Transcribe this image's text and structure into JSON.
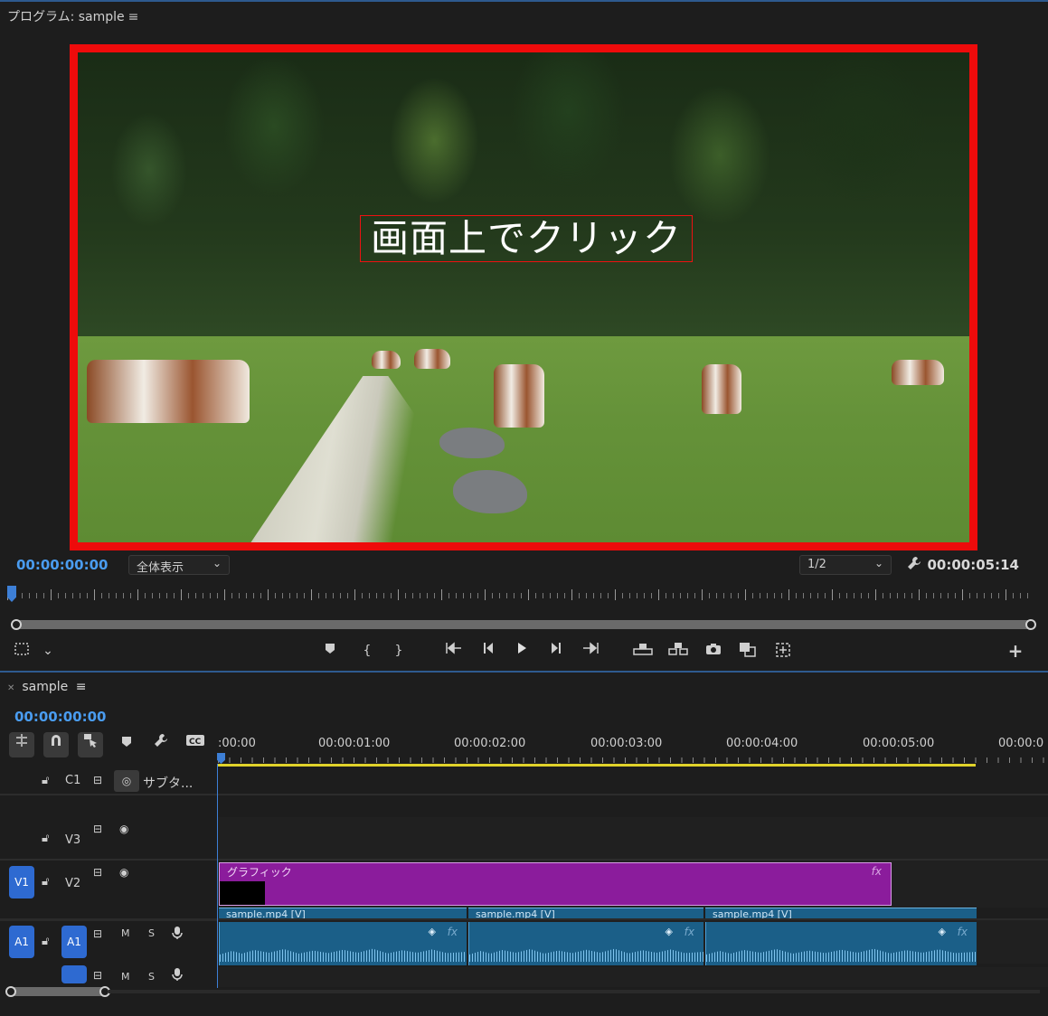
{
  "program_monitor": {
    "title": "プログラム: sample",
    "menu_icon": "≡",
    "overlay_text": "画面上でクリック",
    "current_timecode": "00:00:00:00",
    "duration_timecode": "00:00:05:14",
    "zoom_value": "全体表示",
    "resolution_value": "1/2",
    "highlight_color": "#ee0b0b",
    "accent_color": "#4a9cf0"
  },
  "timeline": {
    "sequence_name": "sample",
    "menu_icon": "≡",
    "current_timecode": "00:00:00:00",
    "ruler_labels": [
      ":00:00",
      "00:00:01:00",
      "00:00:02:00",
      "00:00:03:00",
      "00:00:04:00",
      "00:00:05:00",
      "00:00:0"
    ],
    "tracks": {
      "c1": {
        "name": "C1",
        "label": "サブタ..."
      },
      "v3": {
        "name": "V3"
      },
      "v2": {
        "name": "V2",
        "source_patch": "V1"
      },
      "a1": {
        "name": "A1",
        "source_patch": "A1",
        "m": "M",
        "s": "S"
      },
      "a2": {
        "m": "M",
        "s": "S"
      }
    },
    "clips": {
      "graphic": {
        "label": "グラフィック",
        "fx": "fx",
        "color": "#8b1c9c"
      },
      "video": [
        {
          "label": "sample.mp4 [V]"
        },
        {
          "label": "sample.mp4 [V]"
        },
        {
          "label": "sample.mp4 [V]"
        }
      ],
      "audio": [
        {
          "fx": "fx"
        },
        {
          "fx": "fx"
        },
        {
          "fx": "fx"
        }
      ]
    }
  }
}
